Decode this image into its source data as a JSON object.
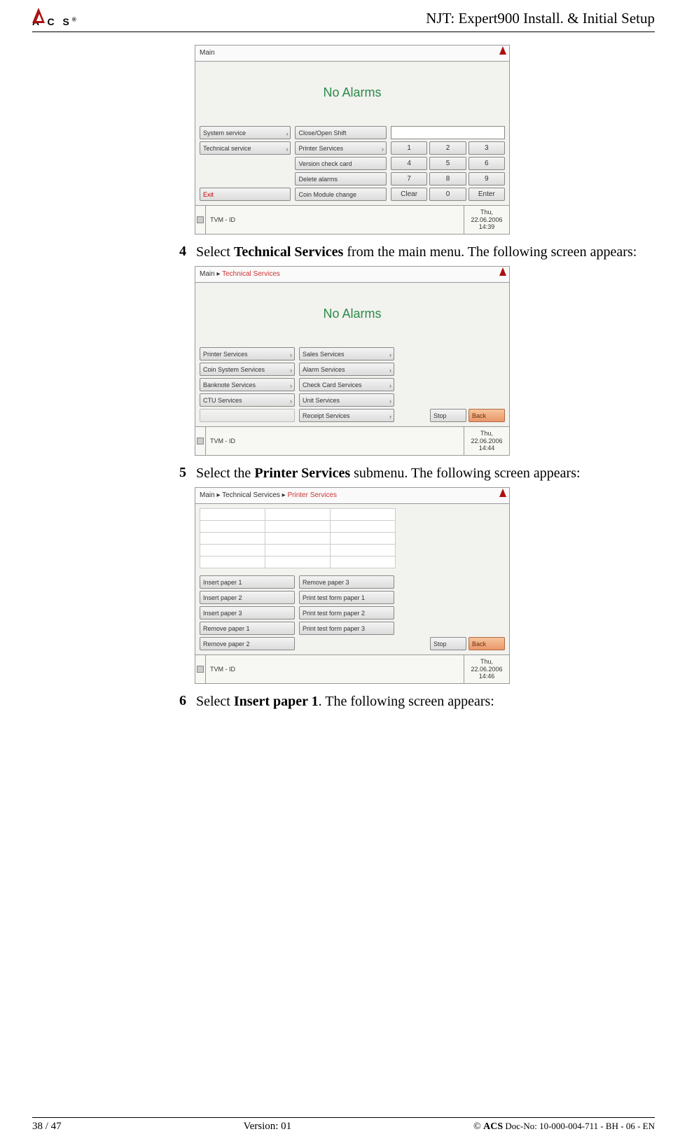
{
  "header": {
    "logo_text": "A  C  S",
    "doc_title": "NJT: Expert900 Install. & Initial Setup"
  },
  "shot1": {
    "breadcrumb": "Main",
    "alarm_text": "No Alarms",
    "col1": [
      "System service",
      "Technical service"
    ],
    "col1_exit": "Exit",
    "col2": [
      "Close/Open Shift",
      "Printer Services",
      "Version check card",
      "Delete alarms",
      "Coin Module change"
    ],
    "keys_clear": "Clear",
    "keys_enter": "Enter",
    "status_left": "TVM - ID",
    "status_right": "Thu, 22.06.2006 14:39"
  },
  "step4": {
    "num": "4",
    "pre": "Select ",
    "bold": "Technical Services",
    "post": " from the main menu. The following screen appears:"
  },
  "shot2": {
    "bc1": "Main ▸ ",
    "bc2": "Technical Services",
    "alarm_text": "No Alarms",
    "col1": [
      "Printer Services",
      "Coin System Services",
      "Banknote Services",
      "CTU Services"
    ],
    "col2": [
      "Sales Services",
      "Alarm Services",
      "Check Card Services",
      "Unit Services",
      "Receipt Services"
    ],
    "stop": "Stop",
    "back": "Back",
    "status_left": "TVM - ID",
    "status_right": "Thu, 22.06.2006 14:44"
  },
  "step5": {
    "num": "5",
    "pre": "Select the ",
    "bold": "Printer Services",
    "post": " submenu. The following screen appears:"
  },
  "shot3": {
    "bc1": "Main ▸ Technical Services ▸ ",
    "bc2": "Printer Services",
    "col1": [
      "Insert paper 1",
      "Insert paper 2",
      "Insert paper 3",
      "Remove paper 1",
      "Remove paper 2"
    ],
    "col2": [
      "Remove paper 3",
      "Print test form paper 1",
      "Print test form paper 2",
      "Print test form paper 3"
    ],
    "stop": "Stop",
    "back": "Back",
    "status_left": "TVM - ID",
    "status_right": "Thu, 22.06.2006 14:46"
  },
  "step6": {
    "num": "6",
    "pre": "Select ",
    "bold": "Insert paper 1",
    "post": ". The following screen appears:"
  },
  "footer": {
    "page": "38 / 47",
    "version": "Version: 01",
    "copy_bold": "ACS",
    "copy_rest": " Doc-No: 10-000-004-711 - BH - 06 - EN"
  }
}
